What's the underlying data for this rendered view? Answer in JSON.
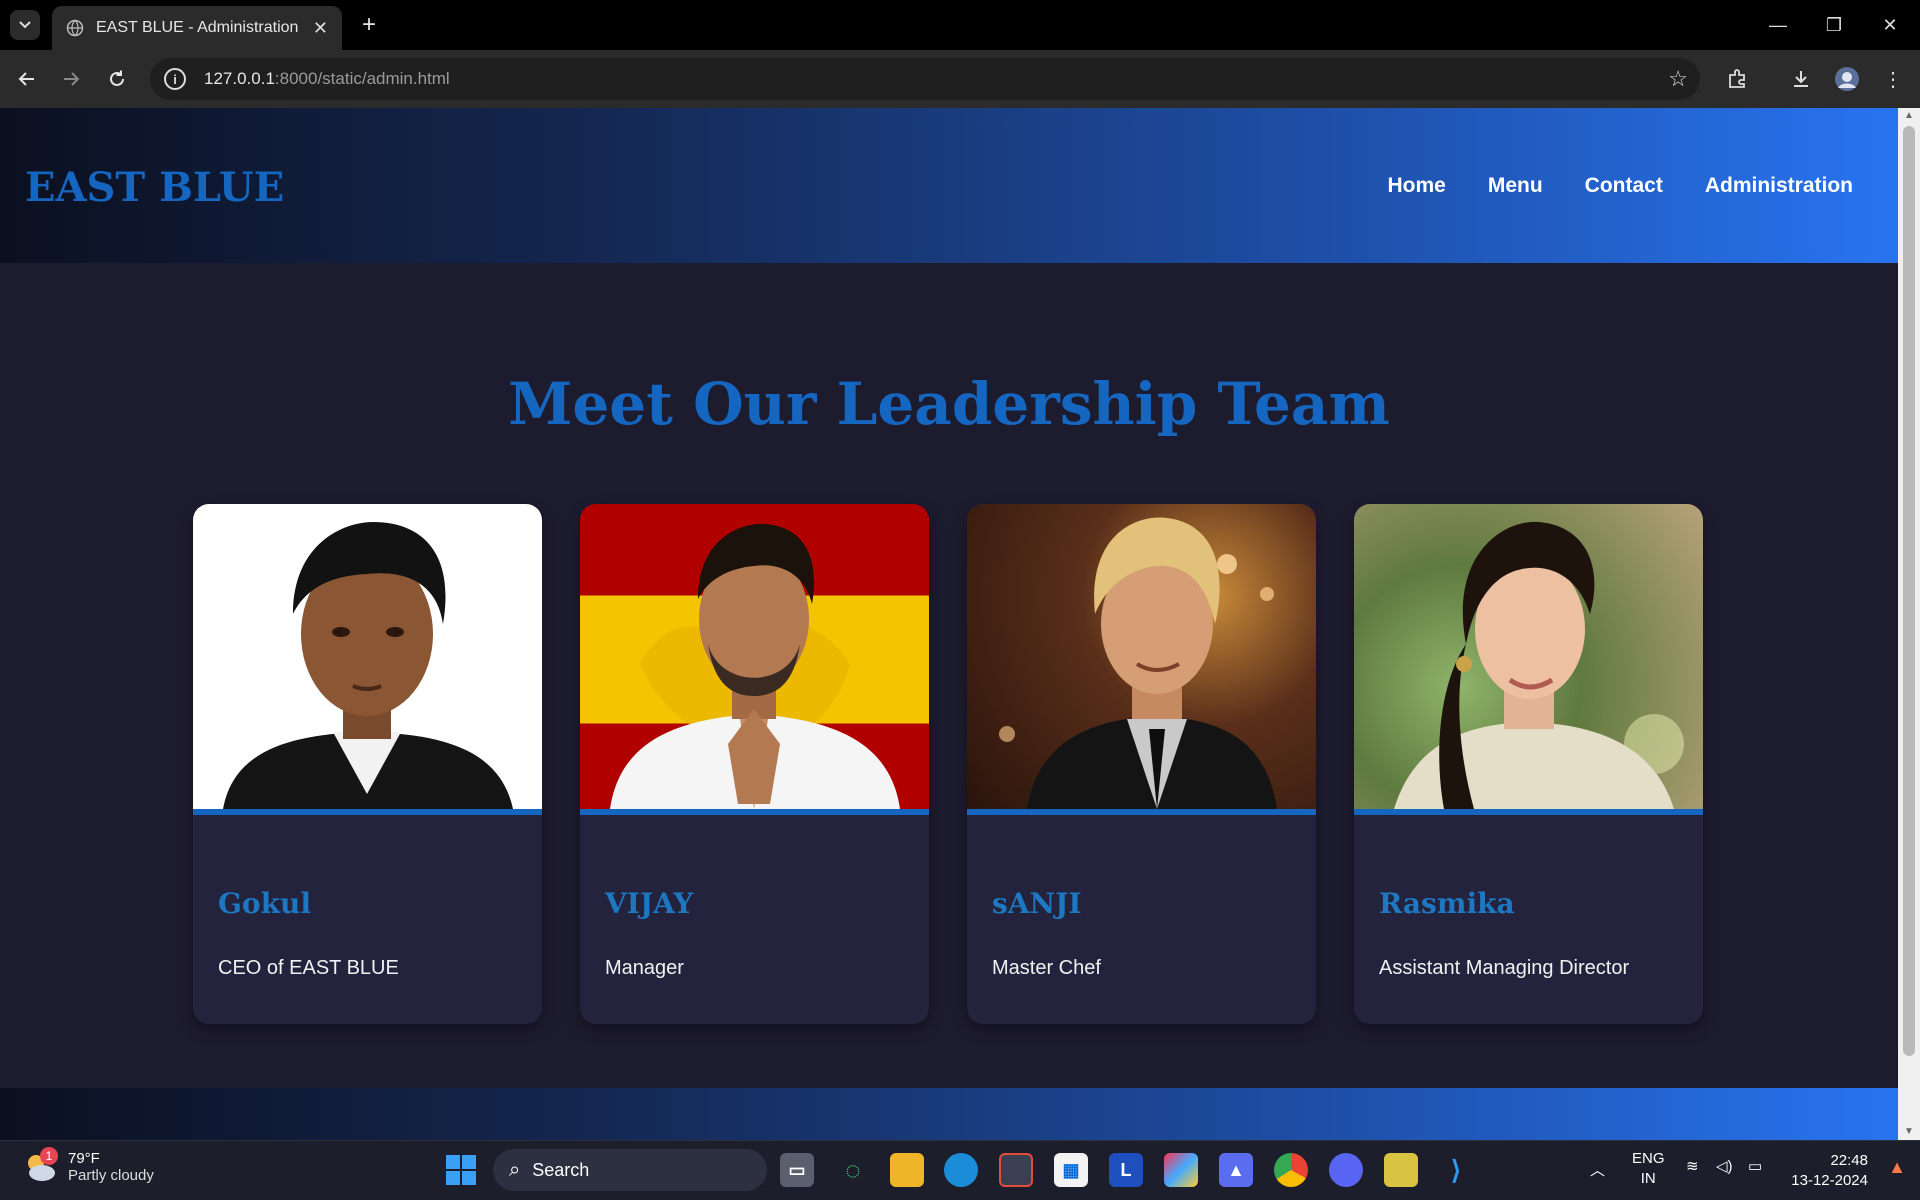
{
  "browser": {
    "tab_title": "EAST BLUE - Administration",
    "tab_close": "✕",
    "new_tab": "+",
    "url_host": "127.0.0.1",
    "url_rest": ":8000/static/admin.html",
    "window_controls": [
      "—",
      "❐",
      "✕"
    ]
  },
  "site": {
    "logo": "EAST BLUE",
    "nav": [
      "Home",
      "Menu",
      "Contact",
      "Administration"
    ],
    "section_title": "Meet Our Leadership Team",
    "team": [
      {
        "name": "Gokul",
        "role": "CEO of EAST BLUE"
      },
      {
        "name": "VIJAY",
        "role": "Manager"
      },
      {
        "name": "sANJI",
        "role": "Master Chef"
      },
      {
        "name": "Rasmika",
        "role": "Assistant Managing Director"
      }
    ]
  },
  "taskbar": {
    "weather_temp": "79°F",
    "weather_desc": "Partly cloudy",
    "weather_badge": "1",
    "search_label": "Search",
    "lang_top": "ENG",
    "lang_bottom": "IN",
    "time": "22:48",
    "date": "13-12-2024"
  },
  "colors": {
    "accent": "#1566c0",
    "page_bg": "#1d1b2e",
    "card_bg": "#23233e"
  }
}
